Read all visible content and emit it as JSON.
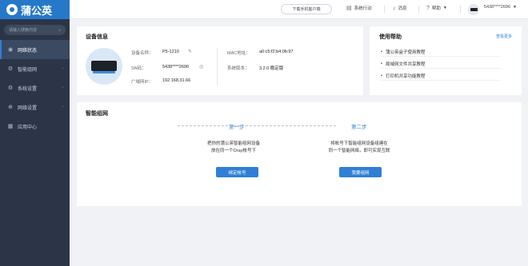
{
  "colors": {
    "sidebar_bg": "#2b3547",
    "accent": "#2f7fd6",
    "logo_bg": "#2678c9"
  },
  "app": {
    "brand": "蒲公英"
  },
  "sidebar": {
    "search_placeholder": "请输入搜索内容",
    "items": [
      {
        "label": "网络状态",
        "icon": "network-status-icon",
        "active": true
      },
      {
        "label": "智能组网",
        "icon": "smart-network-icon",
        "has_arrow": true
      },
      {
        "label": "系统设置",
        "icon": "system-settings-icon",
        "has_arrow": true
      },
      {
        "label": "网络设置",
        "icon": "network-settings-icon",
        "has_arrow": true
      },
      {
        "label": "应用中心",
        "icon": "app-center-icon"
      }
    ]
  },
  "topbar": {
    "download": "下载手机客户端",
    "feedback": "系统行动",
    "messages": "消息",
    "help": "帮助",
    "account": "5438****2696"
  },
  "device_info": {
    "title": "设备信息",
    "fields": {
      "name_label": "设备名称：",
      "name_value": "P5-1210",
      "sn_label": "SN码：",
      "sn_value": "5438****2696",
      "wan_ip_label": "广域网IP：",
      "wan_ip_value": "192.168.31.66",
      "mac_label": "MAC地址：",
      "mac_value": "a0:c5:f2:b4:0b:97",
      "version_label": "系统版本：",
      "version_value": "3.2.0 稳定版"
    }
  },
  "help_panel": {
    "title": "使用帮助",
    "more": "查看更多",
    "items": [
      "蒲公英盒子使用教程",
      "局域网文件共享教程",
      "打印机共享功能教程"
    ]
  },
  "smart_network": {
    "title": "智能组网",
    "step1_title": "第一步",
    "step2_title": "第二步",
    "step1_line1": "把你的蒲公英智能组网设备",
    "step1_line2": "放在同一个Oray帐号下",
    "step2_line1": "将帐号下智能组网设备组建在",
    "step2_line2": "同一个智能网络，即可实现互联",
    "step1_button": "绑定帐号",
    "step2_button": "我要组网"
  }
}
